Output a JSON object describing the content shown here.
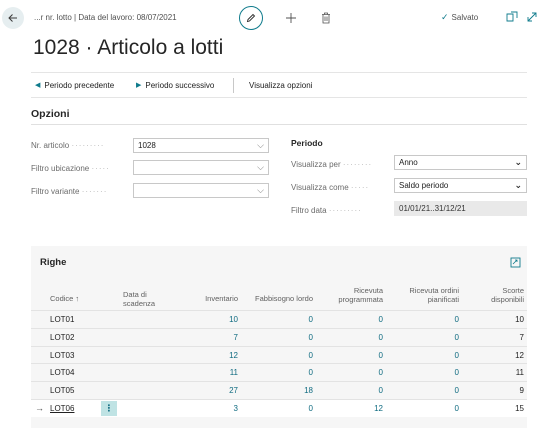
{
  "header": {
    "breadcrumb": "...r nr. lotto | Data del lavoro: 08/07/2021",
    "saved_label": "Salvato",
    "check_glyph": "✓"
  },
  "page": {
    "title": "1028 · Articolo a lotti"
  },
  "actions": {
    "previous": "Periodo precedente",
    "next": "Periodo successivo",
    "show_options": "Visualizza opzioni"
  },
  "options": {
    "title": "Opzioni",
    "item_no": {
      "label": "Nr. articolo",
      "value": "1028"
    },
    "location_filter": {
      "label": "Filtro ubicazione",
      "value": ""
    },
    "variant_filter": {
      "label": "Filtro variante",
      "value": ""
    },
    "period": {
      "title": "Periodo",
      "view_by": {
        "label": "Visualizza per",
        "value": "Anno"
      },
      "view_as": {
        "label": "Visualizza come",
        "value": "Saldo periodo"
      },
      "date_filter": {
        "label": "Filtro data",
        "value": "01/01/21..31/12/21"
      }
    }
  },
  "lines": {
    "title": "Righe",
    "columns": {
      "code": "Codice ↑",
      "expiry_1": "Data di",
      "expiry_2": "scadenza",
      "inventory": "Inventario",
      "gross_req": "Fabbisogno lordo",
      "sched_rec_1": "Ricevuta",
      "sched_rec_2": "programmata",
      "planned_rec_1": "Ricevuta ordini",
      "planned_rec_2": "pianificati",
      "avail_1": "Scorte",
      "avail_2": "disponibili"
    },
    "rows": [
      {
        "code": "LOT01",
        "expiry": "",
        "inventory": "10",
        "gross_req": "0",
        "sched_rec": "0",
        "planned_rec": "0",
        "available": "10"
      },
      {
        "code": "LOT02",
        "expiry": "",
        "inventory": "7",
        "gross_req": "0",
        "sched_rec": "0",
        "planned_rec": "0",
        "available": "7"
      },
      {
        "code": "LOT03",
        "expiry": "",
        "inventory": "12",
        "gross_req": "0",
        "sched_rec": "0",
        "planned_rec": "0",
        "available": "12"
      },
      {
        "code": "LOT04",
        "expiry": "",
        "inventory": "11",
        "gross_req": "0",
        "sched_rec": "0",
        "planned_rec": "0",
        "available": "11"
      },
      {
        "code": "LOT05",
        "expiry": "",
        "inventory": "27",
        "gross_req": "18",
        "sched_rec": "0",
        "planned_rec": "0",
        "available": "9"
      },
      {
        "code": "LOT06",
        "expiry": "",
        "inventory": "3",
        "gross_req": "0",
        "sched_rec": "12",
        "planned_rec": "0",
        "available": "15"
      }
    ],
    "row_arrow": "→",
    "row_menu": "⋮"
  },
  "colors": {
    "accent": "#0f7b8c",
    "link": "#0f6b80",
    "selected_menu_bg": "#bfe3e4",
    "part_bg": "#f6f6f6"
  },
  "icons": [
    "back-arrow-icon",
    "edit-pencil-icon",
    "plus-icon",
    "trash-icon",
    "checkmark-icon",
    "open-new-window-icon",
    "expand-icon",
    "chevron-down-icon",
    "triangle-left-icon",
    "triangle-right-icon",
    "row-arrow-icon",
    "more-options-icon"
  ]
}
